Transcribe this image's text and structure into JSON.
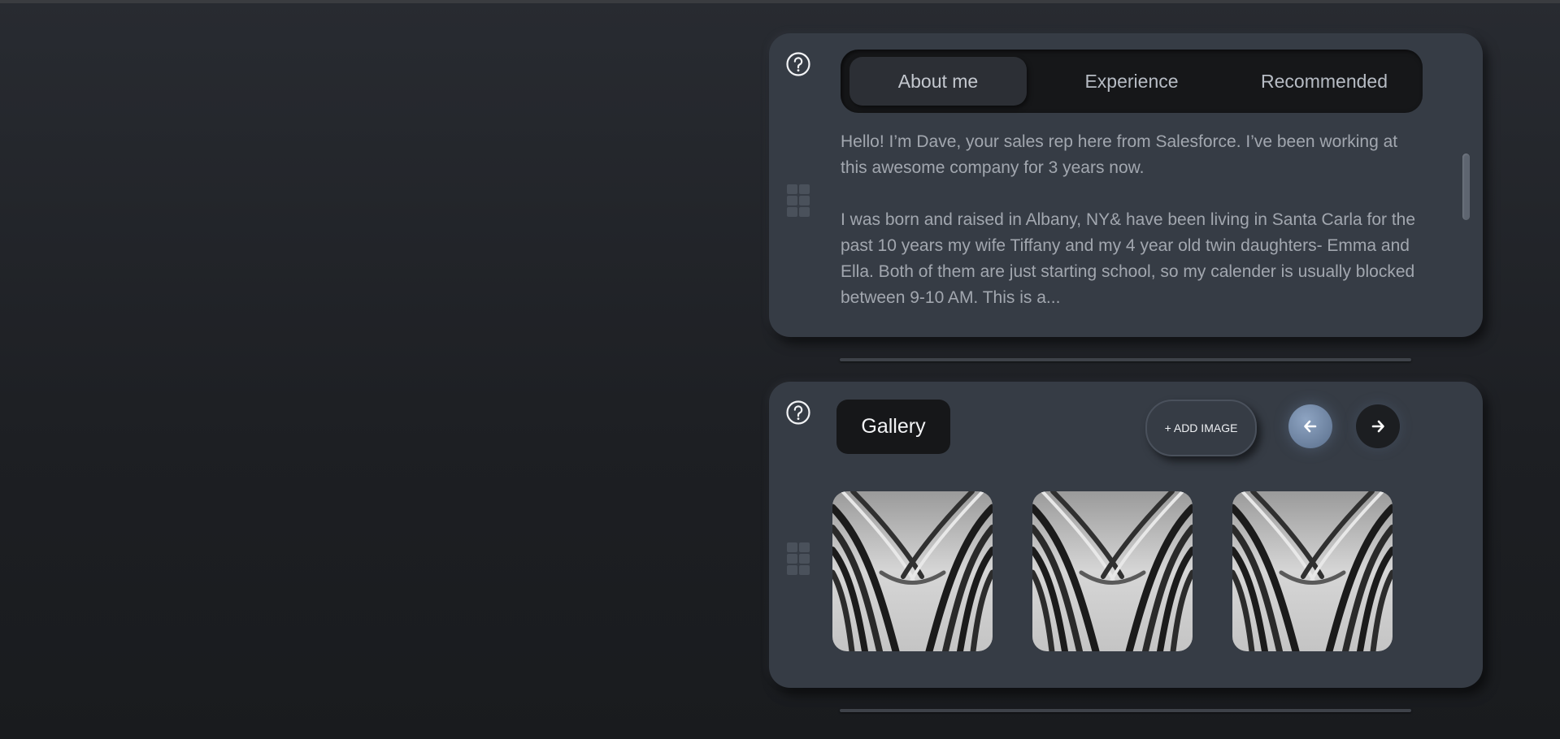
{
  "about_card": {
    "tabs": [
      {
        "label": "About me",
        "active": true
      },
      {
        "label": "Experience",
        "active": false
      },
      {
        "label": "Recommended",
        "active": false
      }
    ],
    "paragraphs": [
      "Hello! I’m Dave, your sales rep here from Salesforce. I’ve been working at this awesome company for 3 years now.",
      "I was born and raised in Albany, NY& have been living in Santa Carla for the past 10 years my wife Tiffany and my 4 year old twin daughters- Emma and Ella. Both of them are just starting school, so my calender is usually blocked between 9-10 AM. This is a..."
    ],
    "help_icon": "question-circle-icon",
    "drag_icon": "grid-handle-icon"
  },
  "gallery_card": {
    "title": "Gallery",
    "add_button_label": "+ ADD IMAGE",
    "prev_icon": "arrow-left-icon",
    "next_icon": "arrow-right-icon",
    "image_count": 3,
    "help_icon": "question-circle-icon",
    "drag_icon": "grid-handle-icon"
  },
  "colors": {
    "background": "#1d1f23",
    "card": "#363c45",
    "pill": "#161719",
    "accent": "#7a90ae"
  }
}
